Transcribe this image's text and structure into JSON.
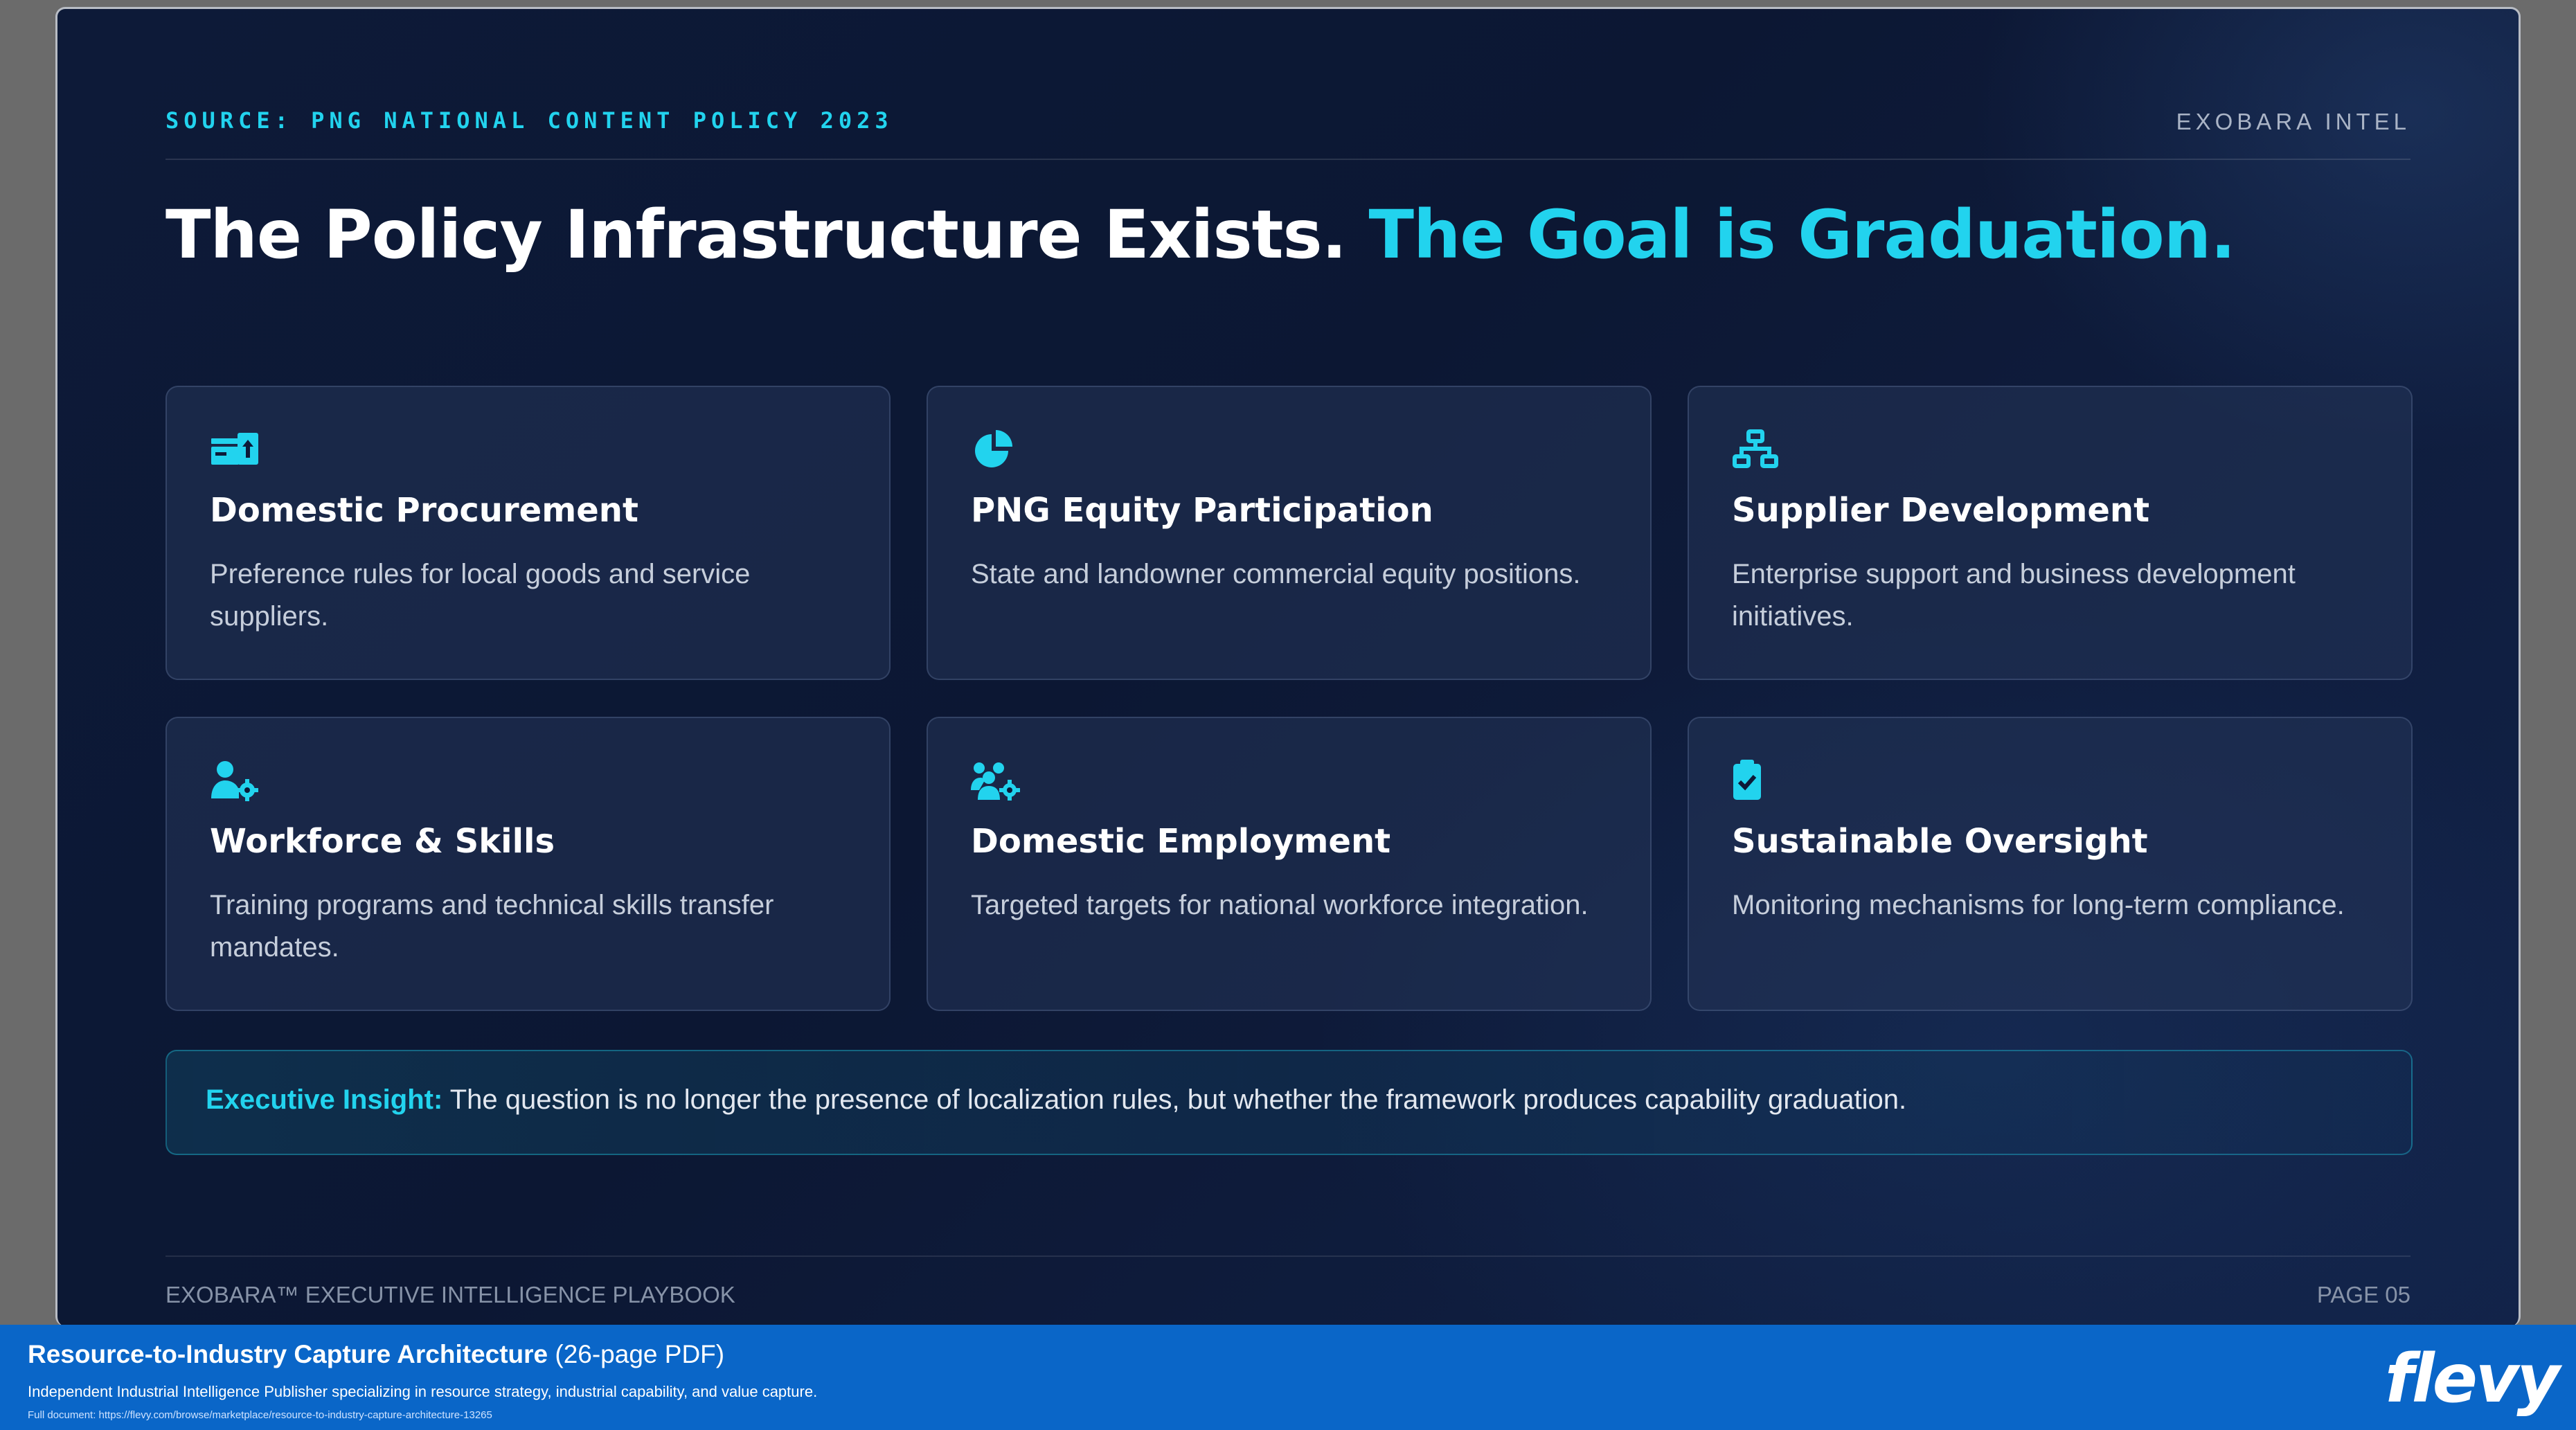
{
  "slide": {
    "source": "SOURCE: PNG NATIONAL CONTENT POLICY 2023",
    "brand": "EXOBARA INTEL",
    "title_main": "The Policy Infrastructure Exists.",
    "title_highlight": "The Goal is Graduation.",
    "accent_color": "#22d3ee",
    "cards": [
      {
        "icon": "procurement-icon",
        "title": "Domestic Procurement",
        "desc": "Preference rules for local goods and service suppliers."
      },
      {
        "icon": "pie-chart-icon",
        "title": "PNG Equity Participation",
        "desc": "State and landowner commercial equity positions."
      },
      {
        "icon": "network-icon",
        "title": "Supplier Development",
        "desc": "Enterprise support and business development initiatives."
      },
      {
        "icon": "user-gear-icon",
        "title": "Workforce & Skills",
        "desc": "Training programs and technical skills transfer mandates."
      },
      {
        "icon": "users-group-icon",
        "title": "Domestic Employment",
        "desc": "Targeted targets for national workforce integration."
      },
      {
        "icon": "clipboard-check-icon",
        "title": "Sustainable Oversight",
        "desc": "Monitoring mechanisms for long-term compliance."
      }
    ],
    "insight": {
      "label": "Executive Insight:",
      "text": "The question is no longer the presence of localization rules, but whether the framework produces capability graduation."
    },
    "footer_left": "EXOBARA™ EXECUTIVE INTELLIGENCE PLAYBOOK",
    "footer_right": "PAGE 05"
  },
  "banner": {
    "title_bold": "Resource-to-Industry Capture Architecture",
    "title_suffix": "(26-page PDF)",
    "description": "Independent Industrial Intelligence Publisher specializing in resource strategy, industrial capability, and value capture.",
    "url": "Full document: https://flevy.com/browse/marketplace/resource-to-industry-capture-architecture-13265",
    "logo": "flevy"
  }
}
